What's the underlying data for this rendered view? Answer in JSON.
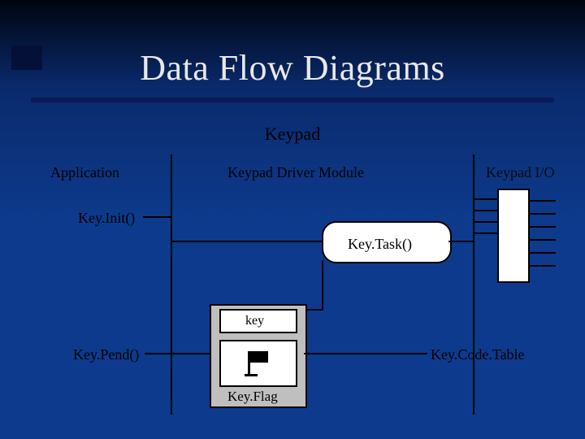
{
  "title": "Data Flow Diagrams",
  "subtitle": "Keypad",
  "columns": {
    "application": "Application",
    "driver": "Keypad Driver Module",
    "io": "Keypad I/O"
  },
  "nodes": {
    "key_init": "Key.Init()",
    "key_task": "Key.Task()",
    "key_pend": "Key.Pend()",
    "key_box": "key",
    "key_flag": "Key.Flag",
    "key_code_table": "Key.Code.Table"
  }
}
